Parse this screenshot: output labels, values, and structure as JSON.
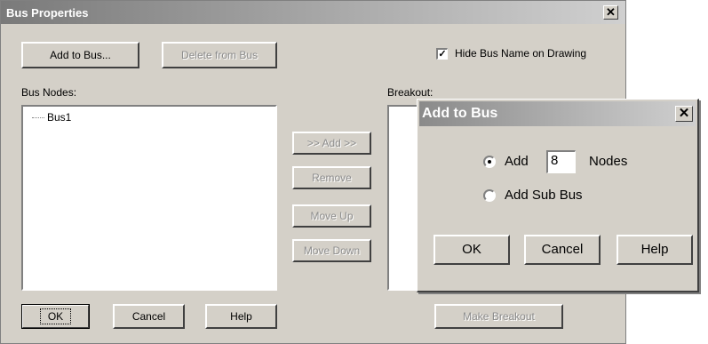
{
  "main_dialog": {
    "title": "Bus Properties",
    "close_glyph": "✕",
    "add_to_bus_button": "Add to Bus...",
    "delete_from_bus_button": "Delete from Bus",
    "hide_bus_name_label": "Hide Bus Name on Drawing",
    "hide_bus_name_checked": true,
    "bus_nodes_label": "Bus Nodes:",
    "bus_nodes_items": [
      "Bus1"
    ],
    "breakout_label": "Breakout:",
    "add_button": ">> Add >>",
    "remove_button": "Remove",
    "move_up_button": "Move Up",
    "move_down_button": "Move Down",
    "ok_button": "OK",
    "cancel_button": "Cancel",
    "help_button": "Help",
    "make_breakout_button": "Make Breakout"
  },
  "add_dialog": {
    "title": "Add to Bus",
    "close_glyph": "✕",
    "add_radio_label": "Add",
    "add_count": "8",
    "nodes_label": "Nodes",
    "add_sub_bus_label": "Add Sub Bus",
    "selected_option": "Add",
    "ok_button": "OK",
    "cancel_button": "Cancel",
    "help_button": "Help"
  }
}
